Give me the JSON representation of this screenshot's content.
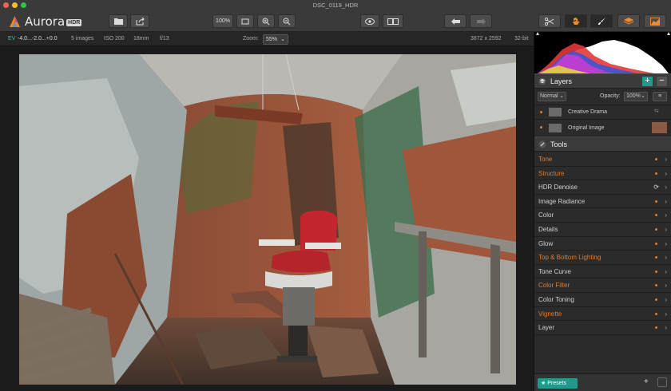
{
  "window": {
    "title": "DSC_0119_HDR"
  },
  "app": {
    "name": "Aurora",
    "badge": "HDR"
  },
  "toolbar": {
    "zoom_100": "100%"
  },
  "infobar": {
    "ev_label": "EV",
    "ev_values": "-4.0...-2.0...+0.0",
    "images": "5 images",
    "iso": "ISO 200",
    "focal": "18mm",
    "aperture": "f/13",
    "zoom_label": "Zoom:",
    "zoom_value": "55%",
    "dimensions": "3872 x 2592",
    "bitdepth": "32-bit"
  },
  "layers": {
    "title": "Layers",
    "blend_mode": "Normal",
    "opacity_label": "Opacity:",
    "opacity_value": "100%",
    "items": [
      {
        "label": "Creative Drama"
      },
      {
        "label": "Original Image"
      }
    ]
  },
  "tools": {
    "title": "Tools",
    "items": [
      {
        "label": "Tone",
        "active": true
      },
      {
        "label": "Structure",
        "active": true
      },
      {
        "label": "HDR Denoise",
        "active": false
      },
      {
        "label": "Image Radiance",
        "active": false
      },
      {
        "label": "Color",
        "active": false
      },
      {
        "label": "Details",
        "active": false
      },
      {
        "label": "Glow",
        "active": false
      },
      {
        "label": "Top & Bottom Lighting",
        "active": true
      },
      {
        "label": "Tone Curve",
        "active": false
      },
      {
        "label": "Color Filter",
        "active": true
      },
      {
        "label": "Color Toning",
        "active": false
      },
      {
        "label": "Vignette",
        "active": true
      },
      {
        "label": "Layer",
        "active": false
      }
    ]
  },
  "presets": {
    "label": "Presets"
  },
  "colors": {
    "accent": "#e07c2c",
    "teal": "#1f9b8c",
    "inactive_text": "#cfcfcf"
  }
}
